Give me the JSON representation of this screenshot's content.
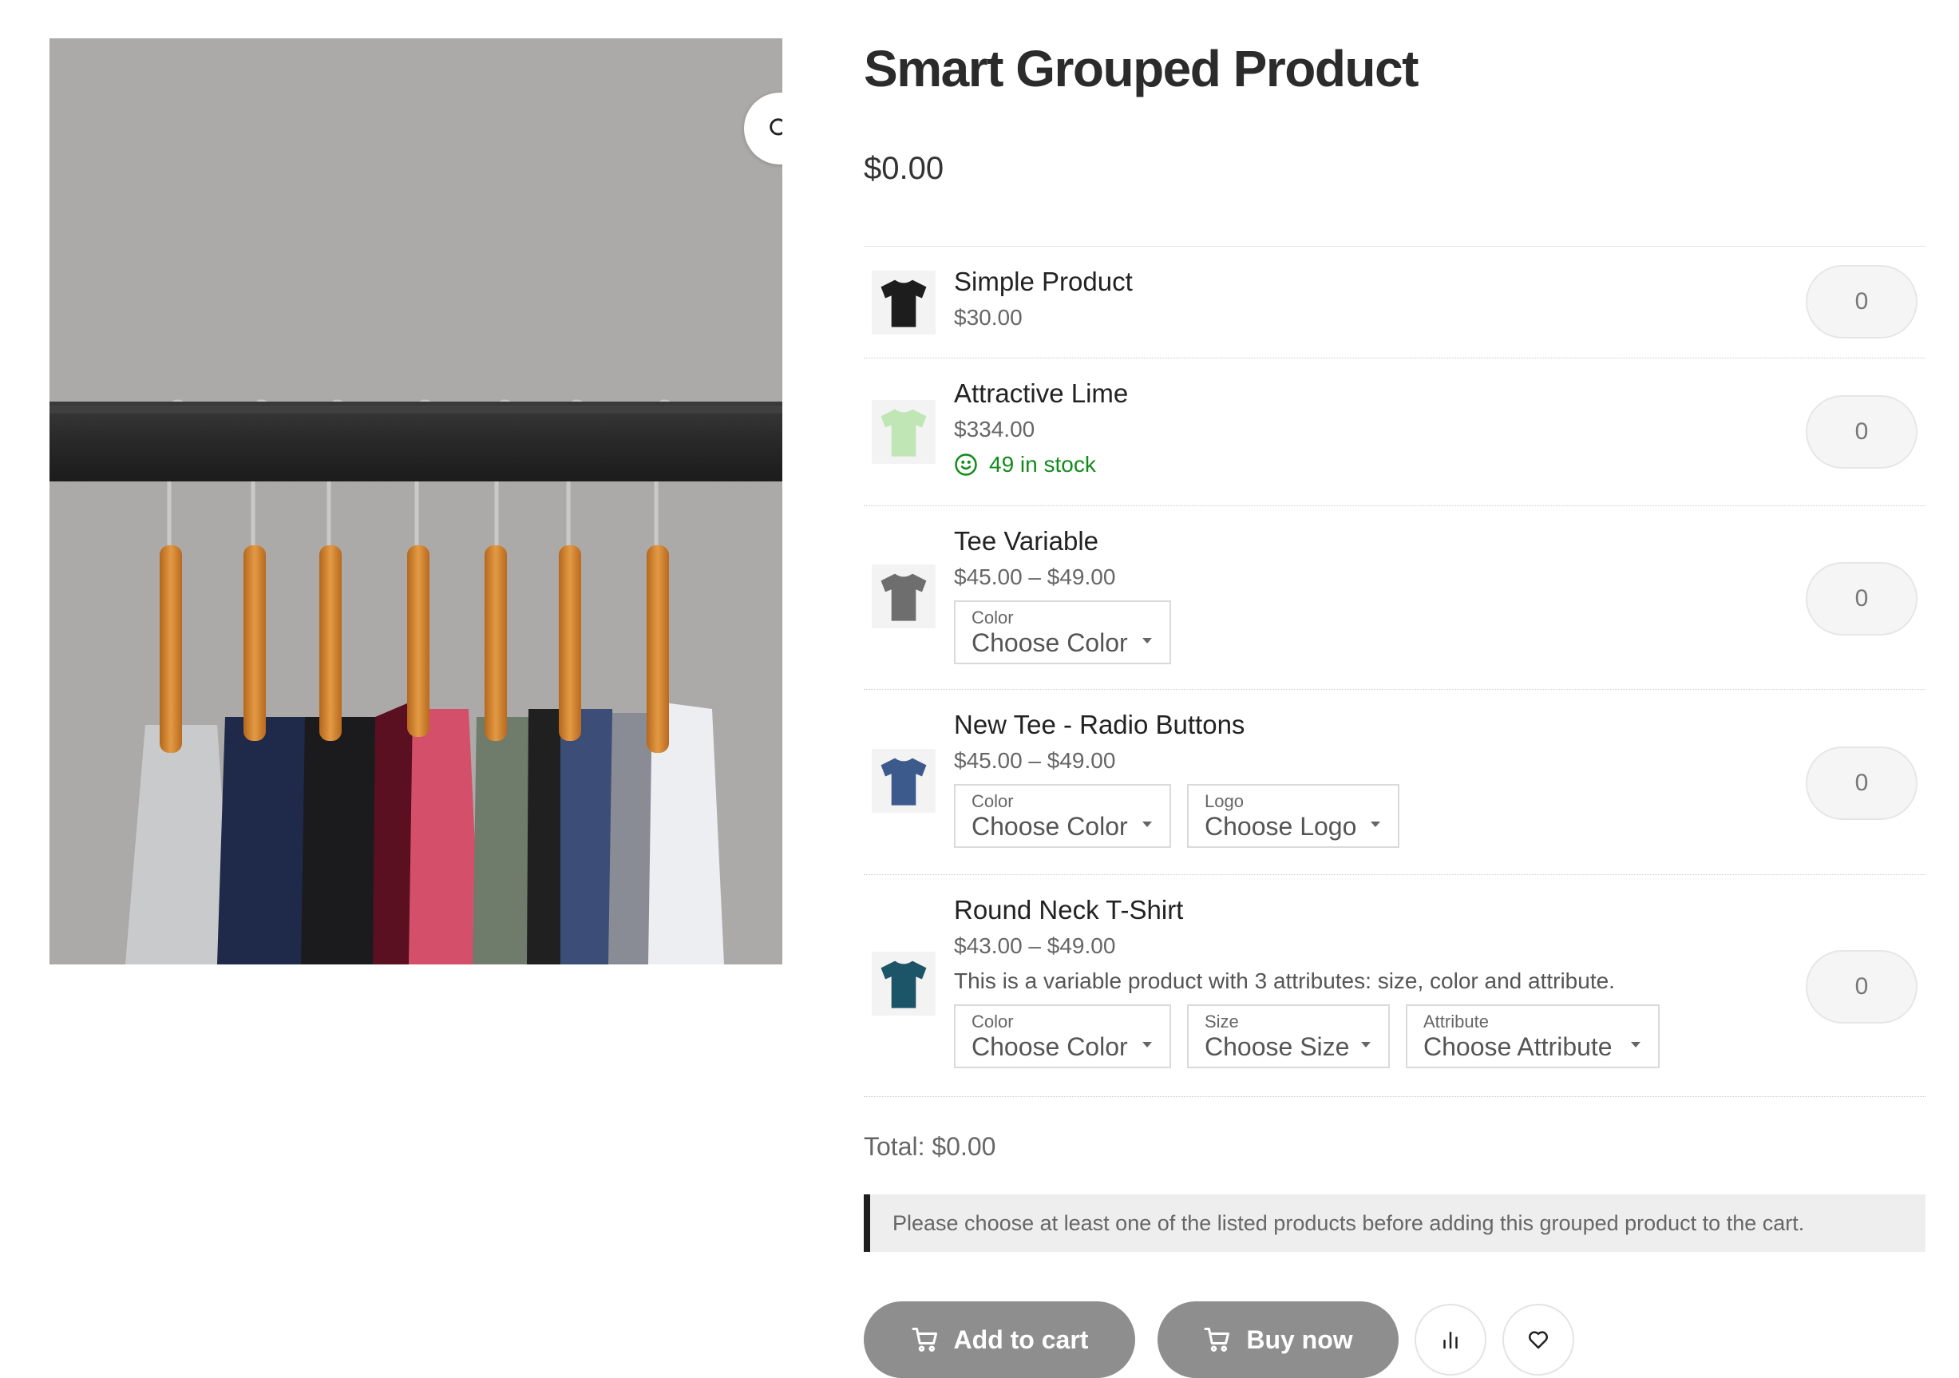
{
  "product": {
    "title": "Smart Grouped Product",
    "price": "$0.00"
  },
  "gallery": {
    "zoom_icon": "search-icon"
  },
  "items": [
    {
      "name": "Simple Product",
      "price": "$30.00",
      "thumb_color": "#1d1d1d",
      "qty": "0"
    },
    {
      "name": "Attractive Lime",
      "price": "$334.00",
      "stock": "49 in stock",
      "thumb_color": "#bfe6b4",
      "qty": "0"
    },
    {
      "name": "Tee Variable",
      "price": "$45.00 – $49.00",
      "thumb_color": "#6e6e6e",
      "selects": [
        {
          "label": "Color",
          "value": "Choose Color"
        }
      ],
      "qty": "0"
    },
    {
      "name": "New Tee - Radio Buttons",
      "price": "$45.00 – $49.00",
      "thumb_color": "#3d5a8c",
      "selects": [
        {
          "label": "Color",
          "value": "Choose Color"
        },
        {
          "label": "Logo",
          "value": "Choose Logo"
        }
      ],
      "qty": "0"
    },
    {
      "name": "Round Neck T-Shirt",
      "price": "$43.00 – $49.00",
      "description": "This is a variable product with 3 attributes: size, color and attribute.",
      "thumb_color": "#1c5468",
      "selects": [
        {
          "label": "Color",
          "value": "Choose Color"
        },
        {
          "label": "Size",
          "value": "Choose Size"
        },
        {
          "label": "Attribute",
          "value": "Choose Attribute"
        }
      ],
      "qty": "0"
    }
  ],
  "total": "Total: $0.00",
  "notice": "Please choose at least one of the listed products before adding this grouped product to the cart.",
  "actions": {
    "add_to_cart": "Add to cart",
    "buy_now": "Buy now",
    "compare_icon": "bar-chart-icon",
    "wishlist_icon": "heart-icon",
    "cart_icon": "cart-icon"
  },
  "colors": {
    "button_bg": "#8e8e8e",
    "stock_green": "#138a1c",
    "notice_border": "#1e1e1e"
  }
}
